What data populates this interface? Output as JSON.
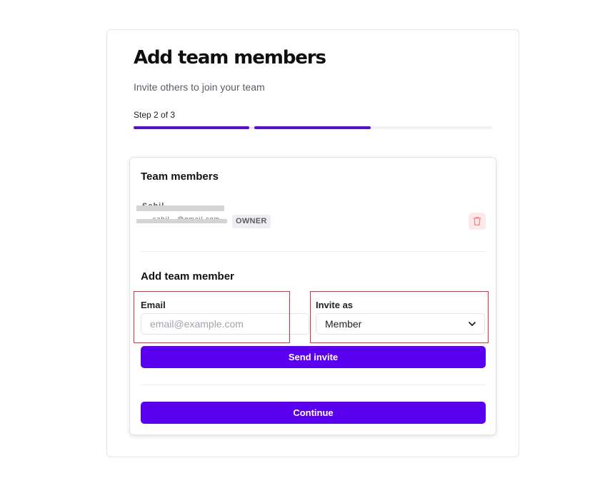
{
  "header": {
    "title": "Add team members",
    "subtitle": "Invite others to join your team",
    "step": "Step 2 of 3",
    "progress": {
      "current": 2,
      "total": 3
    }
  },
  "members_section": {
    "heading": "Team members",
    "members": [
      {
        "name": "Sahil",
        "email": "sahil...@gmail.com",
        "role_badge": "OWNER",
        "delete_icon": "trash-icon"
      }
    ]
  },
  "add_section": {
    "heading": "Add team member",
    "email_label": "Email",
    "email_placeholder": "email@example.com",
    "email_value": "",
    "invite_label": "Invite as",
    "invite_value": "Member",
    "select_icon": "chevron-down-icon",
    "send_label": "Send invite"
  },
  "footer": {
    "continue_label": "Continue"
  },
  "colors": {
    "accent": "#5b00ee",
    "progress_fill": "#5b0ae0",
    "danger_bg": "#fde8ea",
    "danger": "#e88a94",
    "highlight_border": "#e0303f"
  }
}
